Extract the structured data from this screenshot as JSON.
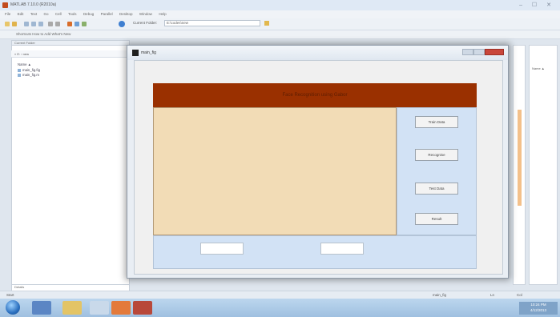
{
  "desktop": {
    "title": "MATLAB 7.10.0 (R2010a)",
    "window_controls": "– ☐ ✕",
    "menu": [
      "File",
      "Edit",
      "Text",
      "Go",
      "Cell",
      "Tools",
      "Debug",
      "Parallel",
      "Desktop",
      "Window",
      "Help"
    ],
    "current_folder_label": "Current Folder:",
    "current_folder_value": "E:\\codes\\new",
    "shortcuts_text": "Shortcuts  How to Add  What's New",
    "left_pane_header": "Current Folder",
    "left_path": "« E: › new",
    "files": [
      "Name ▲",
      "main_fig.fig",
      "main_fig.m"
    ],
    "left_bottom": "Details",
    "right_pane_header": "Name ▲",
    "status_left": "Start",
    "status_mid": "main_fig",
    "status_right_1": "Ln",
    "status_right_2": "Col",
    "clock_time": "10:24 PM",
    "clock_date": "4/12/2013"
  },
  "figure": {
    "title": "main_fig",
    "banner_text": "Face Recognition using Gabor",
    "buttons": [
      "Train Data",
      "Recognise",
      "Test Data",
      "Result"
    ],
    "edit_boxes": [
      "",
      ""
    ]
  },
  "colors": {
    "banner": "#9a3000",
    "axes_bg": "#f2dcb6",
    "panel_bg": "#d2e2f5"
  }
}
